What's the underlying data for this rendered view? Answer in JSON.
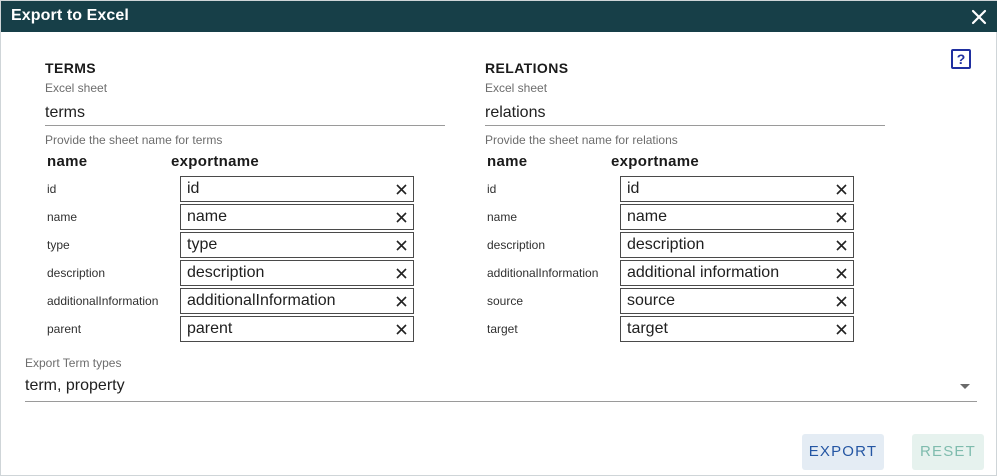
{
  "dialog": {
    "title": "Export to Excel",
    "help_label": "?"
  },
  "terms": {
    "heading": "TERMS",
    "sheet_label": "Excel sheet",
    "sheet_value": "terms",
    "helper": "Provide the sheet name for terms",
    "col_name": "name",
    "col_export": "exportname",
    "rows": [
      {
        "name": "id",
        "export": "id"
      },
      {
        "name": "name",
        "export": "name"
      },
      {
        "name": "type",
        "export": "type"
      },
      {
        "name": "description",
        "export": "description"
      },
      {
        "name": "additionalInformation",
        "export": "additionalInformation"
      },
      {
        "name": "parent",
        "export": "parent"
      }
    ]
  },
  "relations": {
    "heading": "RELATIONS",
    "sheet_label": "Excel sheet",
    "sheet_value": "relations",
    "helper": "Provide the sheet name for relations",
    "col_name": "name",
    "col_export": "exportname",
    "rows": [
      {
        "name": "id",
        "export": "id"
      },
      {
        "name": "name",
        "export": "name"
      },
      {
        "name": "description",
        "export": "description"
      },
      {
        "name": "additionalInformation",
        "export": "additional information"
      },
      {
        "name": "source",
        "export": "source"
      },
      {
        "name": "target",
        "export": "target"
      }
    ]
  },
  "term_types": {
    "label": "Export Term types",
    "value": "term, property"
  },
  "actions": {
    "export_label": "EXPORT",
    "reset_label": "RESET"
  },
  "colors": {
    "titlebar": "#173f48",
    "export_text": "#2456a3",
    "reset_text": "#7fbcae"
  }
}
